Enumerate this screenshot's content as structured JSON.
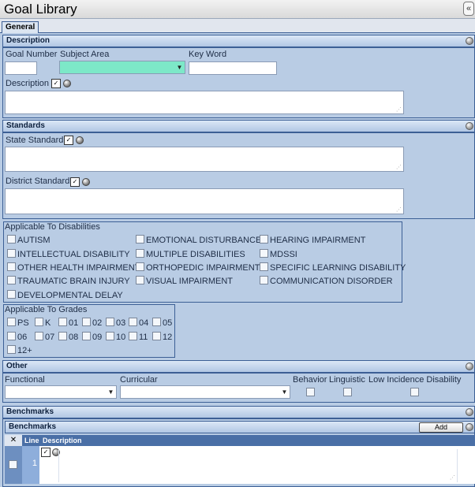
{
  "window": {
    "title": "Goal Library",
    "collapse_glyph": "«"
  },
  "tabs": [
    {
      "label": "General"
    }
  ],
  "description_section": {
    "header": "Description",
    "goal_number_label": "Goal Number",
    "goal_number_value": "",
    "subject_area_label": "Subject Area",
    "subject_area_value": "",
    "key_word_label": "Key Word",
    "key_word_value": "",
    "description_label": "Description",
    "description_value": ""
  },
  "standards_section": {
    "header": "Standards",
    "state_label": "State Standard",
    "state_value": "",
    "district_label": "District Standard",
    "district_value": ""
  },
  "disabilities": {
    "label": "Applicable To Disabilities",
    "items": [
      "AUTISM",
      "EMOTIONAL DISTURBANCE",
      "HEARING IMPAIRMENT",
      "INTELLECTUAL DISABILITY",
      "MULTIPLE DISABILITIES",
      "MDSSI",
      "OTHER HEALTH IMPAIRMENT",
      "ORTHOPEDIC IMPAIRMENT",
      "SPECIFIC LEARNING DISABILITY",
      "TRAUMATIC BRAIN INJURY",
      "VISUAL IMPAIRMENT",
      "COMMUNICATION DISORDER",
      "DEVELOPMENTAL DELAY"
    ]
  },
  "grades": {
    "label": "Applicable To Grades",
    "items": [
      "PS",
      "K",
      "01",
      "02",
      "03",
      "04",
      "05",
      "06",
      "07",
      "08",
      "09",
      "10",
      "11",
      "12",
      "12+"
    ]
  },
  "other_section": {
    "header": "Other",
    "functional_label": "Functional",
    "functional_value": "",
    "curricular_label": "Curricular",
    "curricular_value": "",
    "behavior_label": "Behavior",
    "linguistic_label": "Linguistic",
    "low_incidence_label": "Low Incidence Disability"
  },
  "benchmarks_section": {
    "header": "Benchmarks",
    "subheader": "Benchmarks",
    "add_label": "Add",
    "col_line": "Line",
    "col_description": "Description",
    "rows": [
      {
        "line": "1",
        "description": ""
      }
    ]
  },
  "icons": {
    "collapse": "double-chevron-left-icon",
    "section_toggle": "circle-toggle-icon",
    "spell_check": "spell-check-icon",
    "lookup": "lookup-ball-icon",
    "delete_column": "x-icon",
    "dropdown": "chevron-down-icon"
  }
}
